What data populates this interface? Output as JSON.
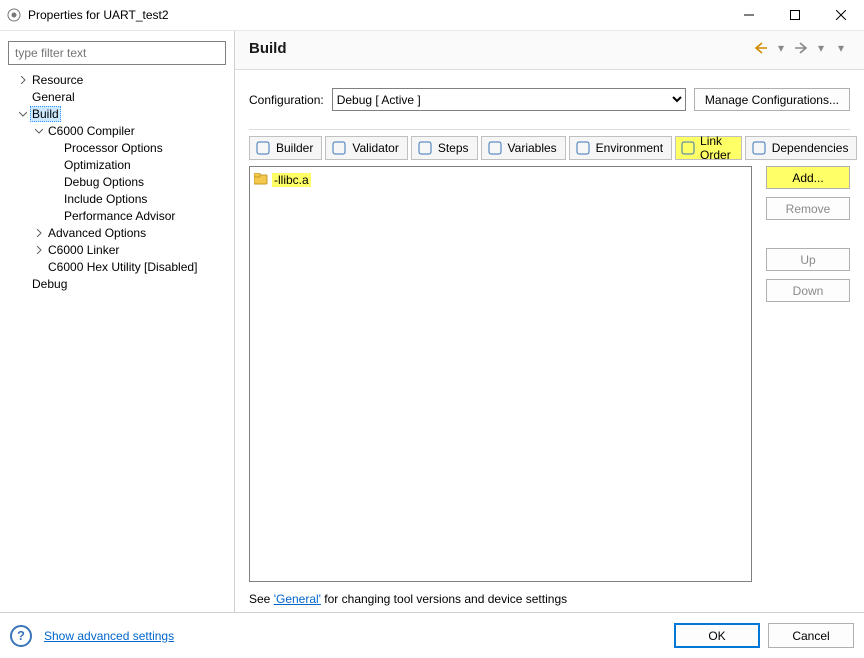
{
  "window": {
    "title": "Properties for UART_test2"
  },
  "filter": {
    "placeholder": "type filter text"
  },
  "tree": [
    {
      "depth": 1,
      "chev": "right",
      "label": "Resource"
    },
    {
      "depth": 1,
      "chev": "",
      "label": "General"
    },
    {
      "depth": 1,
      "chev": "down",
      "label": "Build",
      "selected": true
    },
    {
      "depth": 2,
      "chev": "down",
      "label": "C6000 Compiler"
    },
    {
      "depth": 3,
      "chev": "",
      "label": "Processor Options"
    },
    {
      "depth": 3,
      "chev": "",
      "label": "Optimization"
    },
    {
      "depth": 3,
      "chev": "",
      "label": "Debug Options"
    },
    {
      "depth": 3,
      "chev": "",
      "label": "Include Options"
    },
    {
      "depth": 3,
      "chev": "",
      "label": "Performance Advisor"
    },
    {
      "depth": 2,
      "chev": "right",
      "label": "Advanced Options"
    },
    {
      "depth": 2,
      "chev": "right",
      "label": "C6000 Linker"
    },
    {
      "depth": 2,
      "chev": "",
      "label": "C6000 Hex Utility  [Disabled]"
    },
    {
      "depth": 1,
      "chev": "",
      "label": "Debug"
    }
  ],
  "panel": {
    "title": "Build",
    "config_label": "Configuration:",
    "config_value": "Debug  [ Active ]",
    "manage_btn": "Manage Configurations...",
    "tabs": [
      {
        "icon": "builder-icon",
        "label": "Builder"
      },
      {
        "icon": "validator-icon",
        "label": "Validator"
      },
      {
        "icon": "steps-icon",
        "label": "Steps"
      },
      {
        "icon": "variables-icon",
        "label": "Variables"
      },
      {
        "icon": "environment-icon",
        "label": "Environment"
      },
      {
        "icon": "link-order-icon",
        "label": "Link Order",
        "highlight": true
      },
      {
        "icon": "deps-icon",
        "label": "Dependencies"
      }
    ],
    "link_items": [
      "-llibc.a"
    ],
    "buttons": {
      "add": "Add...",
      "remove": "Remove",
      "up": "Up",
      "down": "Down"
    },
    "footnote_pre": "See ",
    "footnote_link": "'General'",
    "footnote_post": " for changing tool versions and device settings"
  },
  "bottom": {
    "show": "Show advanced settings",
    "ok": "OK",
    "cancel": "Cancel"
  }
}
